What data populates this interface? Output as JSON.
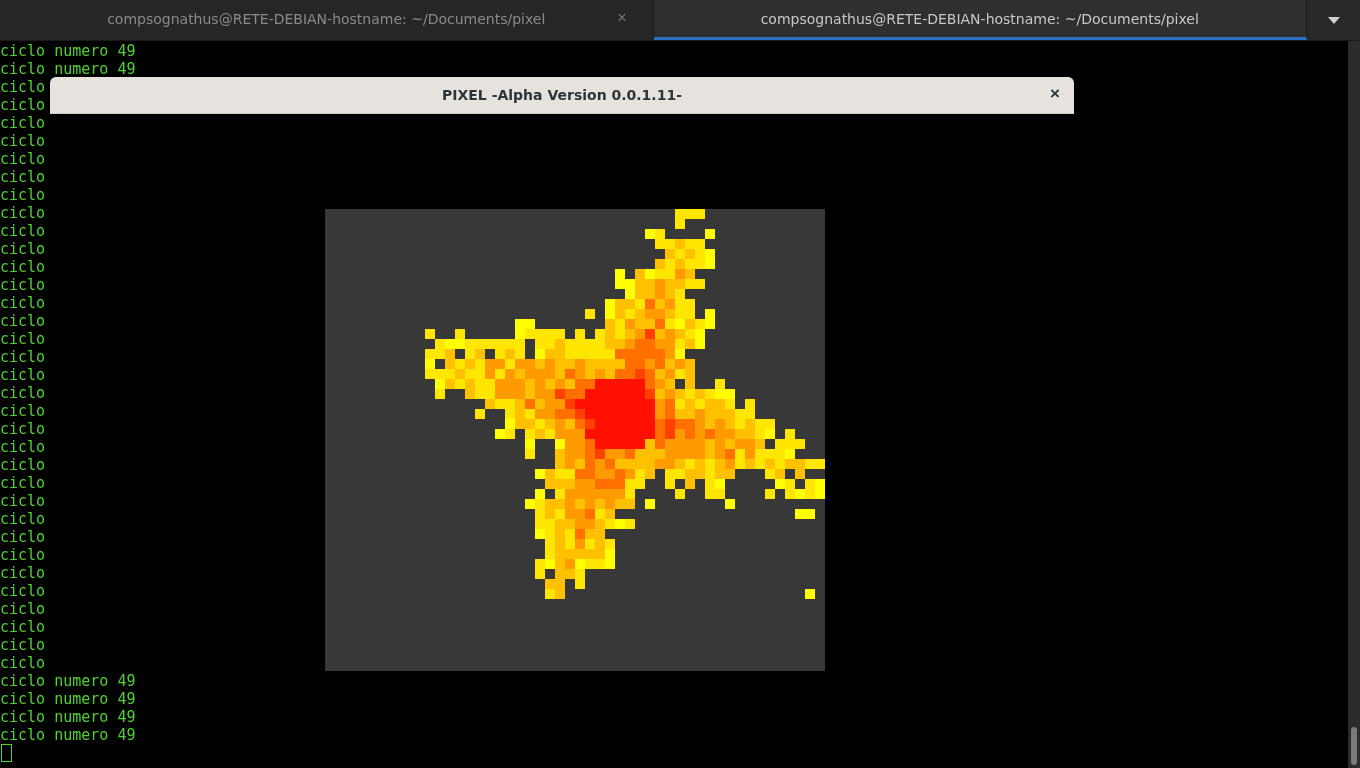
{
  "tabs": [
    {
      "label": "compsognathus@RETE-DEBIAN-hostname: ~/Documents/pixel",
      "selected": false,
      "close": "×"
    },
    {
      "label": "compsognathus@RETE-DEBIAN-hostname: ~/Documents/pixel",
      "selected": true
    }
  ],
  "terminal": {
    "lines": [
      "ciclo numero 49",
      "ciclo numero 49",
      "ciclo",
      "ciclo",
      "ciclo",
      "ciclo",
      "ciclo",
      "ciclo",
      "ciclo",
      "ciclo",
      "ciclo",
      "ciclo",
      "ciclo",
      "ciclo",
      "ciclo",
      "ciclo",
      "ciclo",
      "ciclo",
      "ciclo",
      "ciclo",
      "ciclo",
      "ciclo",
      "ciclo",
      "ciclo",
      "ciclo",
      "ciclo",
      "ciclo",
      "ciclo",
      "ciclo",
      "ciclo",
      "ciclo",
      "ciclo",
      "ciclo",
      "ciclo",
      "ciclo",
      "ciclo numero 49",
      "ciclo numero 49",
      "ciclo numero 49",
      "ciclo numero 49"
    ]
  },
  "dialog": {
    "title": "PIXEL -Alpha Version 0.0.1.11-",
    "close": "×"
  }
}
